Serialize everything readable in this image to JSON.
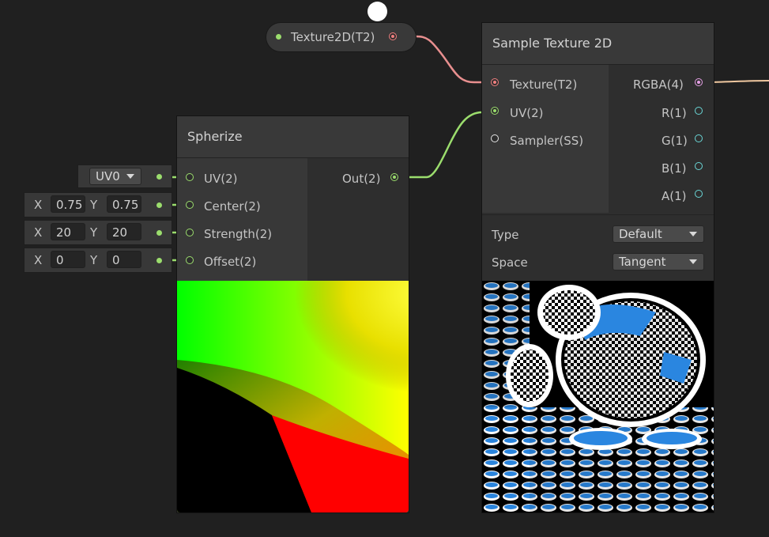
{
  "property_node": {
    "label": "Texture2D(T2)"
  },
  "spherize": {
    "title": "Spherize",
    "inputs": [
      "UV(2)",
      "Center(2)",
      "Strength(2)",
      "Offset(2)"
    ],
    "output": "Out(2)",
    "uv_dropdown": "UV0",
    "center": {
      "x_label": "X",
      "x": "0.75",
      "y_label": "Y",
      "y": "0.75"
    },
    "strength": {
      "x_label": "X",
      "x": "20",
      "y_label": "Y",
      "y": "20"
    },
    "offset": {
      "x_label": "X",
      "x": "0",
      "y_label": "Y",
      "y": "0"
    }
  },
  "sample_texture": {
    "title": "Sample Texture 2D",
    "inputs": [
      "Texture(T2)",
      "UV(2)",
      "Sampler(SS)"
    ],
    "outputs": [
      "RGBA(4)",
      "R(1)",
      "G(1)",
      "B(1)",
      "A(1)"
    ],
    "type_label": "Type",
    "type_value": "Default",
    "space_label": "Space",
    "space_value": "Tangent"
  },
  "colors": {
    "background": "#202020",
    "texture_port": "#f07f7f",
    "vector2_port": "#9bdd6d",
    "vector4_port": "#e6a0e6",
    "float_port": "#6ad6d6",
    "wire_texture": "#e88f8f",
    "wire_uv": "#9bdd6d",
    "wire_rgba": "#f0c8a0"
  },
  "icons": [
    "dropdown-arrow-icon",
    "port-icon"
  ]
}
